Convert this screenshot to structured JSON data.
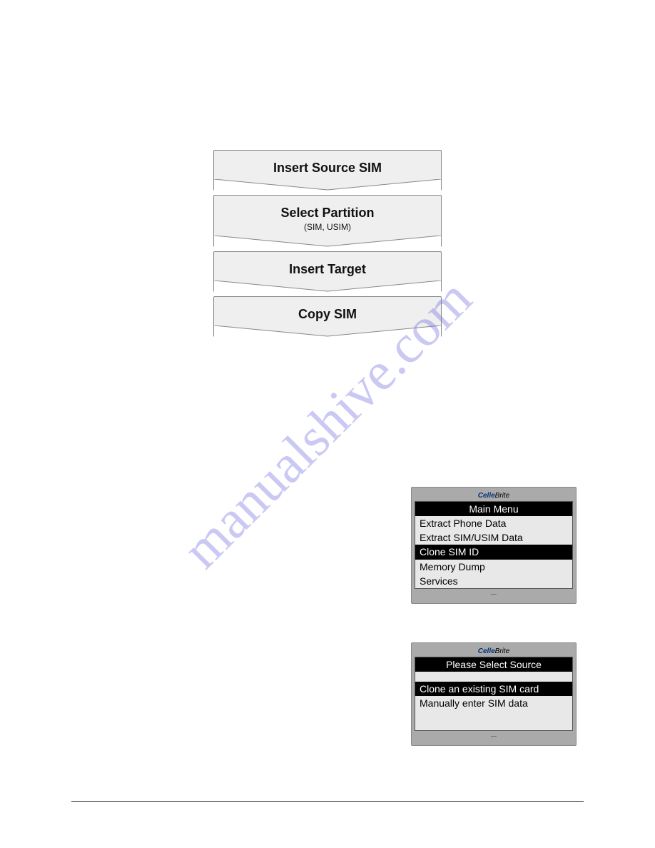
{
  "watermark": "manualshive.com",
  "flow": {
    "step1": {
      "title": "Insert Source SIM"
    },
    "step2": {
      "title": "Select Partition",
      "sub": "(SIM, USIM)"
    },
    "step3": {
      "title": "Insert Target"
    },
    "step4": {
      "title": "Copy SIM"
    }
  },
  "screen1": {
    "logo_bold": "Celle",
    "logo_rest": "Brite",
    "title": "Main Menu",
    "items": [
      {
        "label": "Extract Phone Data",
        "selected": false
      },
      {
        "label": "Extract SIM/USIM Data",
        "selected": false
      },
      {
        "label": "Clone SIM ID",
        "selected": true
      },
      {
        "label": "Memory Dump",
        "selected": false
      },
      {
        "label": "Services",
        "selected": false
      }
    ]
  },
  "screen2": {
    "logo_bold": "Celle",
    "logo_rest": "Brite",
    "title": "Please Select Source",
    "items": [
      {
        "label": "Clone an existing SIM card",
        "selected": true
      },
      {
        "label": "Manually enter SIM data",
        "selected": false
      }
    ]
  }
}
